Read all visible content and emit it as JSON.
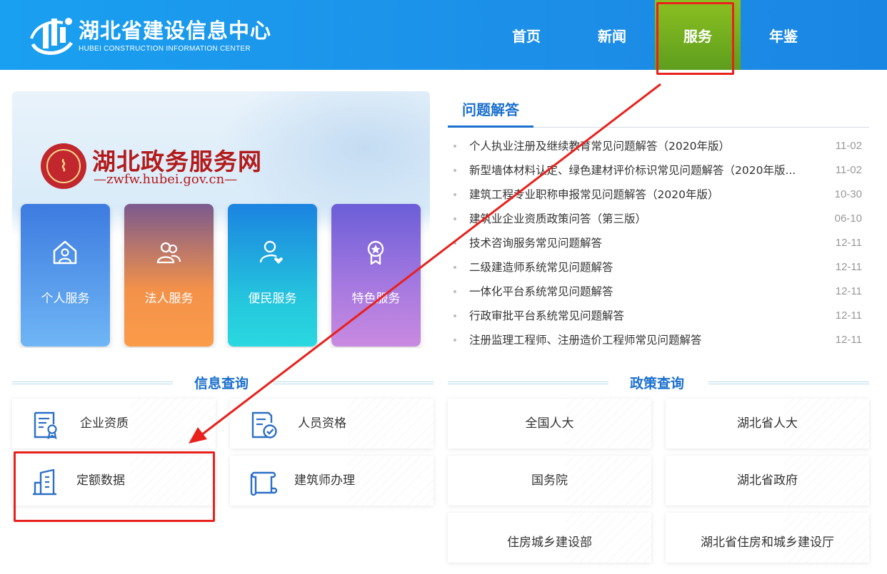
{
  "header": {
    "site_name_cn": "湖北省建设信息中心",
    "site_name_en": "HUBEI CONSTRUCTION INFORMATION CENTER",
    "nav": [
      {
        "label": "首页",
        "active": false
      },
      {
        "label": "新闻",
        "active": false
      },
      {
        "label": "服务",
        "active": true
      },
      {
        "label": "年鉴",
        "active": false
      }
    ]
  },
  "banner": {
    "title": "湖北政务服务网",
    "url": "—zwfw.hubei.gov.cn—",
    "services": [
      {
        "label": "个人服务",
        "icon": "house-person-icon"
      },
      {
        "label": "法人服务",
        "icon": "people-group-icon"
      },
      {
        "label": "便民服务",
        "icon": "person-heart-icon"
      },
      {
        "label": "特色服务",
        "icon": "star-badge-icon"
      }
    ]
  },
  "faq": {
    "title": "问题解答",
    "items": [
      {
        "text": "个人执业注册及继续教育常见问题解答（2020年版）",
        "date": "11-02"
      },
      {
        "text": "新型墙体材料认定、绿色建材评价标识常见问题解答（2020年版...",
        "date": "11-02"
      },
      {
        "text": "建筑工程专业职称申报常见问题解答（2020年版）",
        "date": "10-30"
      },
      {
        "text": "建筑业企业资质政策问答（第三版）",
        "date": "06-10"
      },
      {
        "text": "技术咨询服务常见问题解答",
        "date": "12-11"
      },
      {
        "text": "二级建造师系统常见问题解答",
        "date": "12-11"
      },
      {
        "text": "一体化平台系统常见问题解答",
        "date": "12-11"
      },
      {
        "text": "行政审批平台系统常见问题解答",
        "date": "12-11"
      },
      {
        "text": "注册监理工程师、注册造价工程师常见问题解答",
        "date": "12-11"
      }
    ]
  },
  "info_query": {
    "title": "信息查询",
    "items": [
      {
        "label": "企业资质",
        "icon": "certificate-doc-icon"
      },
      {
        "label": "人员资格",
        "icon": "doc-check-icon"
      },
      {
        "label": "定额数据",
        "icon": "building-icon"
      },
      {
        "label": "建筑师办理",
        "icon": "scroll-icon"
      }
    ]
  },
  "policy_query": {
    "title": "政策查询",
    "items": [
      {
        "label": "全国人大"
      },
      {
        "label": "湖北省人大"
      },
      {
        "label": "国务院"
      },
      {
        "label": "湖北省政府"
      },
      {
        "label": "住房城乡建设部"
      },
      {
        "label": "湖北省住房和城乡建设厅"
      }
    ]
  },
  "colors": {
    "header_blue": "#1c8fe8",
    "nav_active_green": "#6fae1f",
    "title_blue": "#1a6fce",
    "annotation_red": "#e8211c"
  }
}
